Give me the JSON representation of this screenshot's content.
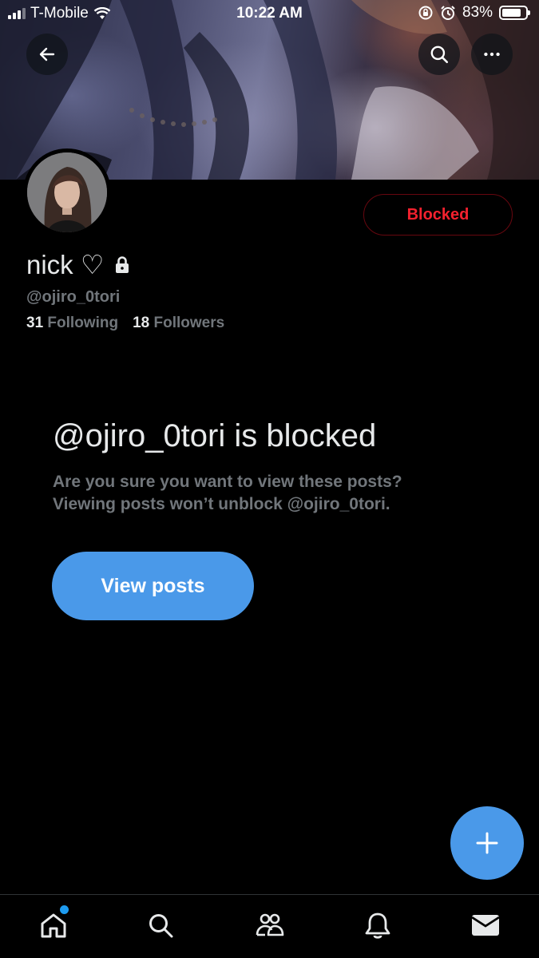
{
  "status_bar": {
    "carrier": "T-Mobile",
    "time": "10:22 AM",
    "battery_percent": "83%",
    "battery_level": 0.83
  },
  "header": {
    "back_icon": "arrow-left-icon",
    "search_icon": "search-icon",
    "more_icon": "more-horizontal-icon"
  },
  "profile": {
    "display_name": "nick ♡",
    "protected_icon": "lock-icon",
    "handle": "@ojiro_0tori",
    "following_count": "31",
    "following_label": "Following",
    "followers_count": "18",
    "followers_label": "Followers",
    "blocked_button_label": "Blocked"
  },
  "blocked_notice": {
    "title": "@ojiro_0tori is blocked",
    "subtitle_line1": "Are you sure you want to view these posts?",
    "subtitle_line2": "Viewing posts won’t unblock @ojiro_0tori.",
    "view_button_label": "View posts"
  },
  "fab": {
    "icon": "plus-icon"
  },
  "bottom_nav": {
    "items": [
      "home-icon",
      "search-icon",
      "communities-icon",
      "notifications-icon",
      "messages-icon"
    ],
    "active": "home-icon"
  },
  "colors": {
    "background": "#000000",
    "accent_blue": "#4a99e9",
    "blocked_red": "#f4212e",
    "muted_text": "#71767b",
    "primary_text": "#e7e9ea"
  }
}
